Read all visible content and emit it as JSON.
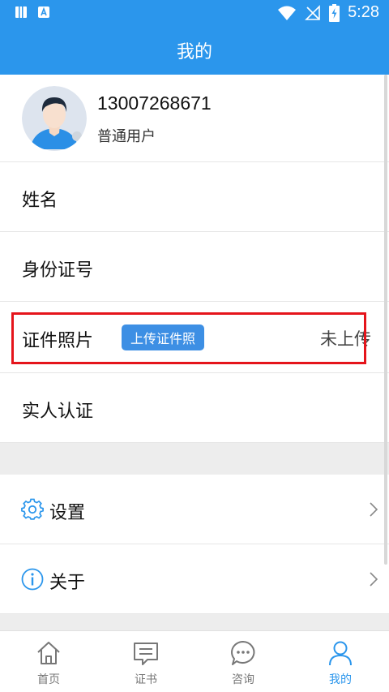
{
  "status_bar": {
    "time": "5:28",
    "icons": [
      "sim-card-icon",
      "app-notification-icon",
      "wifi-icon",
      "no-signal-icon",
      "battery-charging-icon"
    ]
  },
  "header": {
    "title": "我的"
  },
  "profile": {
    "phone": "13007268671",
    "user_type": "普通用户"
  },
  "rows": {
    "name_label": "姓名",
    "id_label": "身份证号",
    "photo_label": "证件照片",
    "upload_button": "上传证件照",
    "photo_status": "未上传",
    "verify_label": "实人认证"
  },
  "settings": [
    {
      "label": "设置",
      "icon": "gear-icon"
    },
    {
      "label": "关于",
      "icon": "info-icon"
    }
  ],
  "tabs": [
    {
      "label": "首页",
      "icon": "home-icon"
    },
    {
      "label": "证书",
      "icon": "certificate-icon"
    },
    {
      "label": "咨询",
      "icon": "chat-icon"
    },
    {
      "label": "我的",
      "icon": "person-icon",
      "active": true
    }
  ],
  "colors": {
    "primary": "#2b96ec",
    "highlight": "#e5141b",
    "upload_button": "#3d8fe4"
  }
}
